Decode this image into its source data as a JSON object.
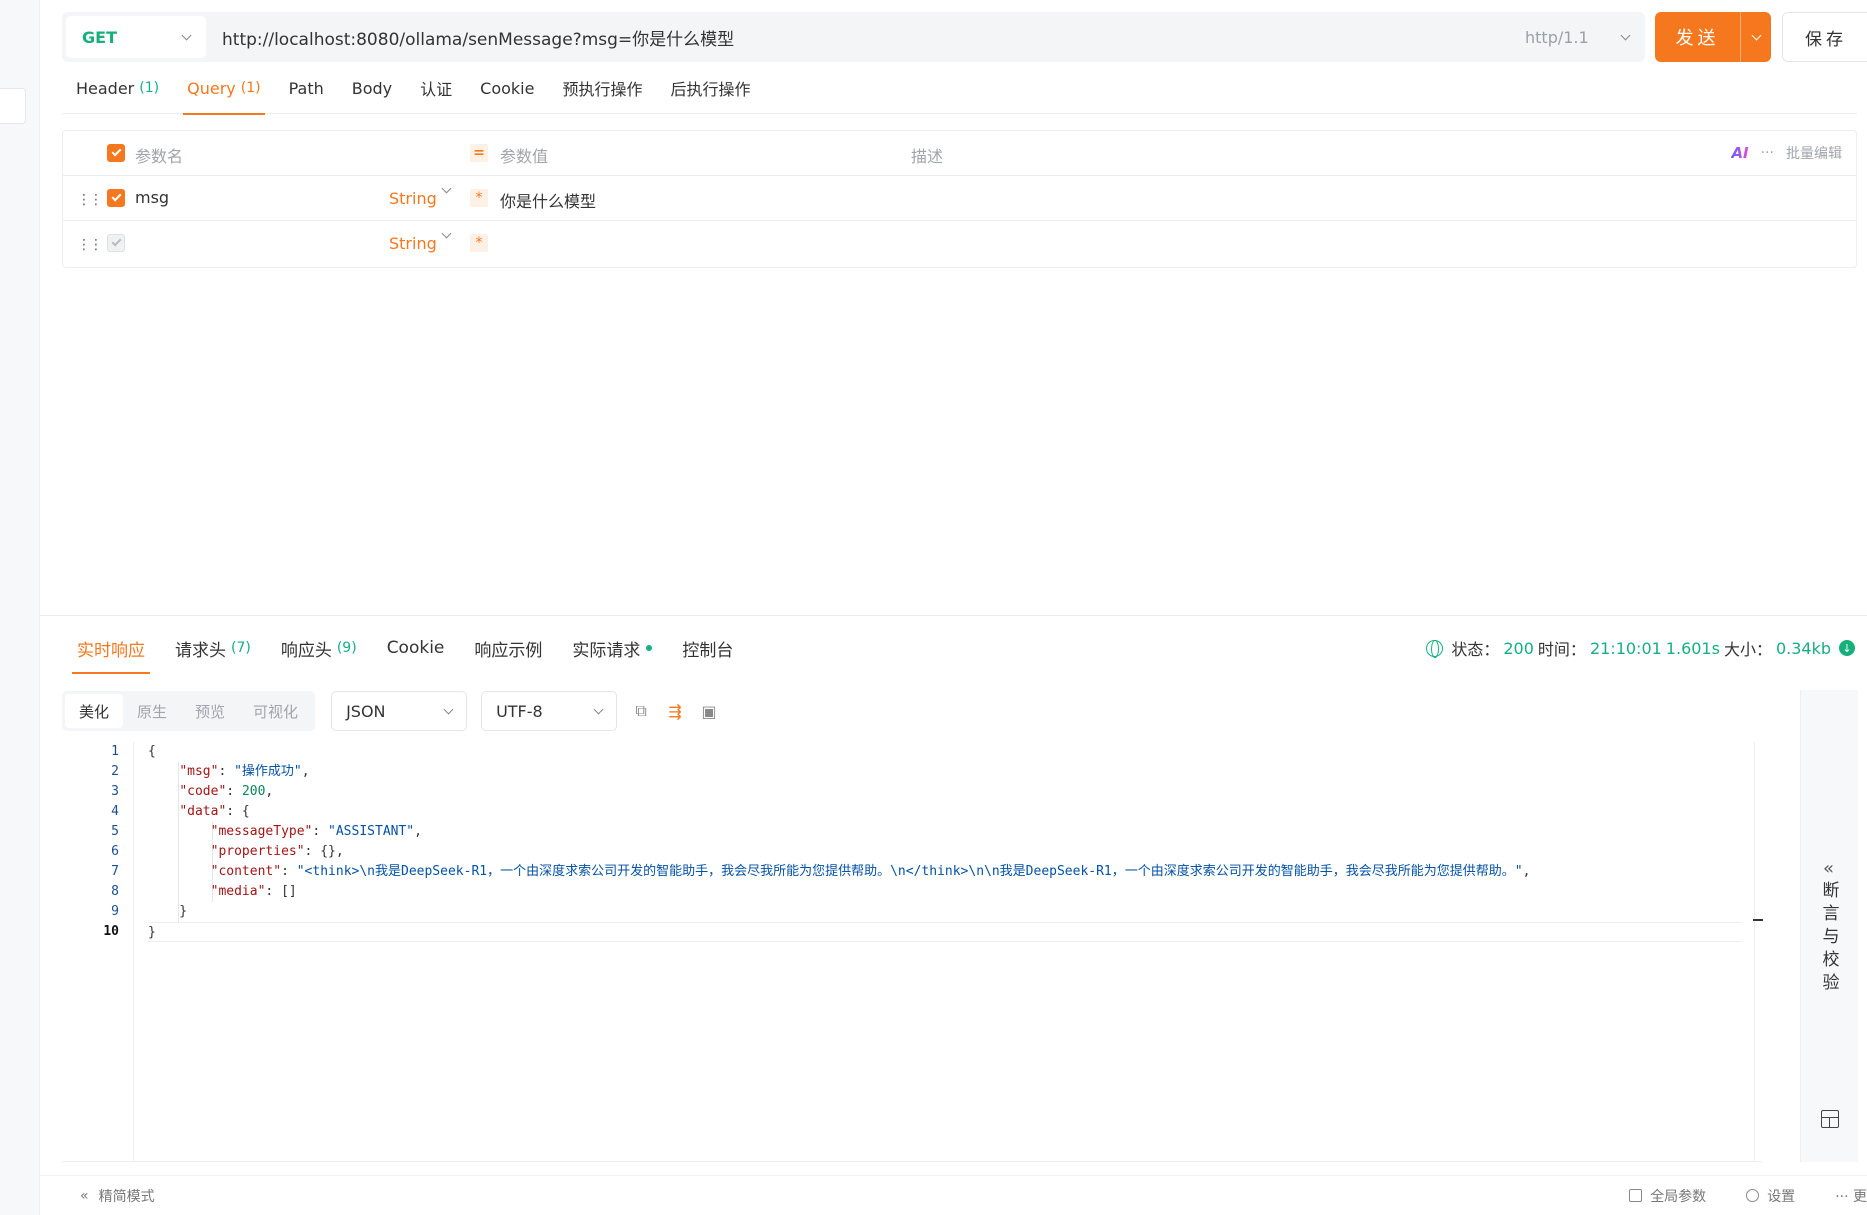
{
  "request": {
    "method": "GET",
    "url": "http://localhost:8080/ollama/senMessage?msg=你是什么模型",
    "protocol": "http/1.1",
    "send_label": "发送",
    "save_label": "保存"
  },
  "request_tabs": [
    {
      "label": "Header",
      "count": "(1)"
    },
    {
      "label": "Query",
      "count": "(1)"
    },
    {
      "label": "Path",
      "count": ""
    },
    {
      "label": "Body",
      "count": ""
    },
    {
      "label": "认证",
      "count": ""
    },
    {
      "label": "Cookie",
      "count": ""
    },
    {
      "label": "预执行操作",
      "count": ""
    },
    {
      "label": "后执行操作",
      "count": ""
    }
  ],
  "params": {
    "header": {
      "name": "参数名",
      "value": "参数值",
      "description": "描述",
      "ai": "AI",
      "more": "···",
      "bulk_edit": "批量编辑"
    },
    "rows": [
      {
        "name": "msg",
        "type": "String",
        "value": "你是什么模型",
        "enabled": true
      },
      {
        "name": "",
        "type": "String",
        "value": "",
        "enabled": false
      }
    ]
  },
  "response_tabs": [
    {
      "label": "实时响应",
      "count": ""
    },
    {
      "label": "请求头",
      "count": "(7)"
    },
    {
      "label": "响应头",
      "count": "(9)"
    },
    {
      "label": "Cookie",
      "count": ""
    },
    {
      "label": "响应示例",
      "count": ""
    },
    {
      "label": "实际请求",
      "count": ""
    },
    {
      "label": "控制台",
      "count": ""
    }
  ],
  "status": {
    "status_label": "状态：",
    "status_value": "200",
    "time_label": "时间：",
    "time_value": "21:10:01",
    "duration": "1.601s",
    "size_label": "大小：",
    "size_value": "0.34kb"
  },
  "view_modes": [
    "美化",
    "原生",
    "预览",
    "可视化"
  ],
  "format": "JSON",
  "encoding": "UTF-8",
  "code": {
    "line_numbers": [
      "1",
      "2",
      "3",
      "4",
      "5",
      "6",
      "7",
      "8",
      "9",
      "10"
    ],
    "msg_value": "\"操作成功\"",
    "code_value": "200",
    "message_type": "\"ASSISTANT\"",
    "content_value": "\"<think>\\n我是DeepSeek-R1，一个由深度求索公司开发的智能助手，我会尽我所能为您提供帮助。\\n</think>\\n\\n我是DeepSeek-R1，一个由深度求索公司开发的智能助手，我会尽我所能为您提供帮助。\""
  },
  "assert_panel": {
    "label": "断言与校验"
  },
  "footer": {
    "simple_mode": "精简模式",
    "global_params": "全局参数",
    "settings": "设置",
    "more": "··· 更"
  }
}
